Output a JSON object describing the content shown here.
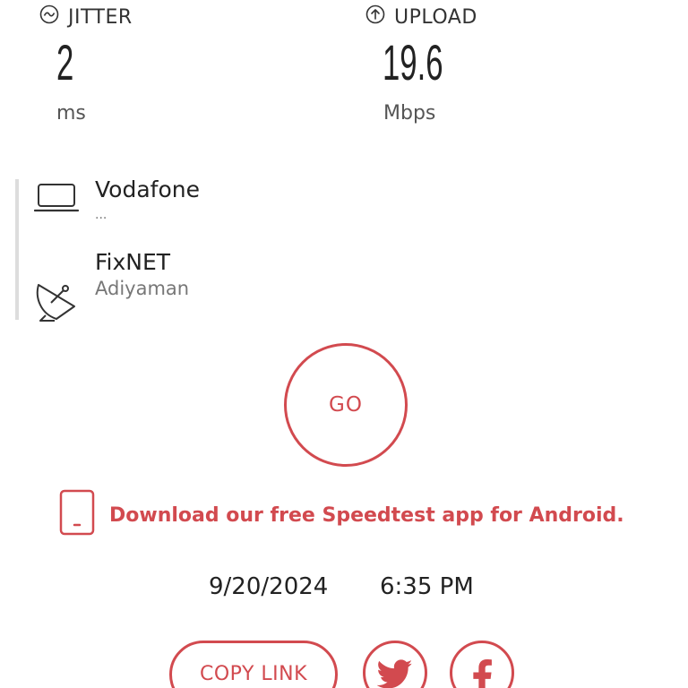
{
  "metrics": {
    "jitter": {
      "label": "JITTER",
      "value": "2",
      "unit": "ms",
      "icon": "jitter-wave-icon"
    },
    "upload": {
      "label": "UPLOAD",
      "value": "19.6",
      "unit": "Mbps",
      "icon": "upload-arrow-icon"
    }
  },
  "servers": {
    "provider": {
      "name": "Vodafone",
      "detail": "...",
      "icon": "laptop-icon"
    },
    "host": {
      "name": "FixNET",
      "detail": "Adiyaman",
      "icon": "satellite-dish-icon"
    }
  },
  "go_button": {
    "label": "GO"
  },
  "promo": {
    "text": "Download our free Speedtest app for Android.",
    "icon": "mobile-phone-icon"
  },
  "result": {
    "date": "9/20/2024",
    "time": "6:35 PM"
  },
  "share": {
    "copy_link_label": "COPY LINK",
    "twitter_icon": "twitter-bird-icon",
    "facebook_icon": "facebook-f-icon"
  },
  "colors": {
    "accent": "#d24a4f",
    "text": "#222222",
    "muted": "#777777",
    "divider": "#dddddd"
  }
}
